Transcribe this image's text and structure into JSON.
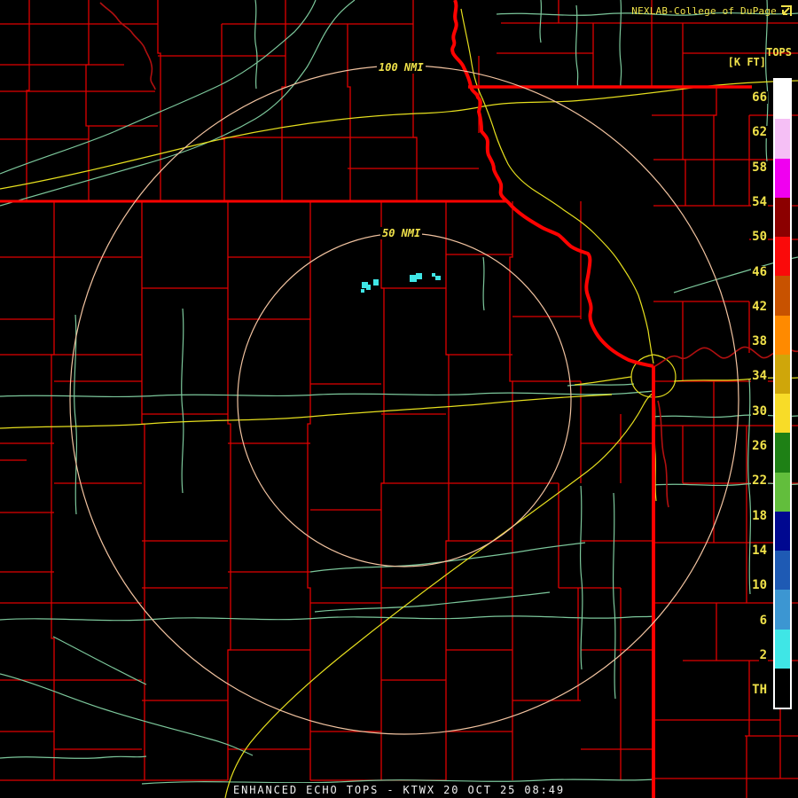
{
  "header": {
    "title": "NEXLAB-College of DuPage"
  },
  "scale": {
    "title": "TOPS",
    "units": "[K FT]",
    "labels": [
      "66",
      "62",
      "58",
      "54",
      "50",
      "46",
      "42",
      "38",
      "34",
      "30",
      "26",
      "22",
      "18",
      "14",
      "10",
      "6",
      "2",
      "TH"
    ],
    "block_colors": [
      "#FFFFFF",
      "#F5BFF5",
      "#F000F0",
      "#8C0000",
      "#FA0A0A",
      "#C85200",
      "#FF8A00",
      "#CFA60A",
      "#F8DC28",
      "#1E8015",
      "#62BE3C",
      "#000890",
      "#1E5AB4",
      "#3C96D2",
      "#3FE6E6",
      "#000000"
    ]
  },
  "rings": {
    "outer_label": "100 NMI",
    "inner_label": "50 NMI"
  },
  "footer": {
    "caption": "ENHANCED ECHO TOPS - KTWX 20 OCT 25 08:49"
  },
  "colors": {
    "county": "#DF0000",
    "state": "#FF0200",
    "river": "#7CC79B",
    "road": "#E6DF1E",
    "darkriver": "#B01010",
    "ring": "#F2C3A0",
    "labelyellow": "#F0E24A",
    "caption": "#F0F0F0"
  },
  "echoes": {
    "color": "#3FE6E6",
    "cells": [
      [
        408,
        318,
        7,
        7
      ],
      [
        413,
        321,
        5,
        6
      ],
      [
        407,
        326,
        4,
        4
      ],
      [
        421,
        315,
        6,
        7
      ],
      [
        462,
        310,
        8,
        8
      ],
      [
        469,
        308,
        7,
        7
      ],
      [
        487,
        308,
        4,
        4
      ],
      [
        491,
        311,
        6,
        5
      ]
    ]
  }
}
